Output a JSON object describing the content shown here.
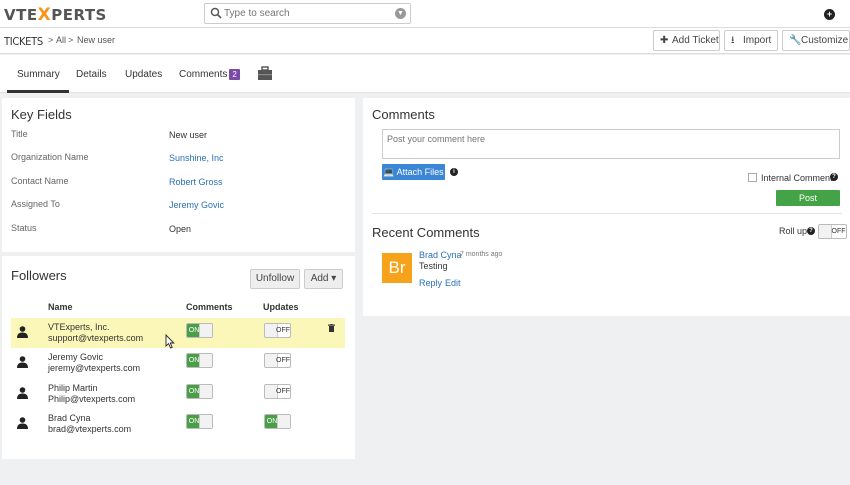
{
  "brand": {
    "prefix": "VTE",
    "x": "X",
    "suffix": "PERTS"
  },
  "search": {
    "placeholder": "Type to search"
  },
  "header": {
    "module": "TICKETS",
    "sep1": ">",
    "crumb_all": "All",
    "sep2": ">",
    "crumb_record": "New user",
    "add_ticket": "Add Ticket",
    "import": "Import",
    "customize": "Customize"
  },
  "tabs": {
    "summary": "Summary",
    "details": "Details",
    "updates": "Updates",
    "comments": "Comments",
    "comments_count": "2"
  },
  "key_fields": {
    "title": "Key Fields",
    "rows": [
      {
        "label": "Title",
        "value": "New user"
      },
      {
        "label": "Organization Name",
        "value": "Sunshine, Inc"
      },
      {
        "label": "Contact Name",
        "value": "Robert Gross"
      },
      {
        "label": "Assigned To",
        "value": "Jeremy Govic"
      },
      {
        "label": "Status",
        "value": "Open"
      }
    ]
  },
  "followers": {
    "title": "Followers",
    "unfollow": "Unfollow",
    "add": "Add",
    "col_name": "Name",
    "col_comments": "Comments",
    "col_updates": "Updates",
    "rows": [
      {
        "name": "VTExperts, Inc.",
        "email": "support@vtexperts.com",
        "comments": "ON",
        "updates": "OFF"
      },
      {
        "name": "Jeremy Govic",
        "email": "jeremy@vtexperts.com",
        "comments": "ON",
        "updates": "OFF"
      },
      {
        "name": "Philip Martin",
        "email": "Philip@vtexperts.com",
        "comments": "ON",
        "updates": "OFF"
      },
      {
        "name": "Brad Cyna",
        "email": "brad@vtexperts.com",
        "comments": "ON",
        "updates": "ON"
      }
    ]
  },
  "comments": {
    "title": "Comments",
    "placeholder": "Post your comment here",
    "attach": "Attach Files",
    "internal": "Internal Comment",
    "post": "Post",
    "recent_title": "Recent Comments",
    "rollup": "Roll up",
    "rollup_state": "OFF",
    "items": [
      {
        "avatar": "Br",
        "author": "Brad Cyna",
        "time": "7 months ago",
        "text": "Testing",
        "reply": "Reply",
        "edit": "Edit"
      }
    ]
  },
  "colors": {
    "accent": "#2a6fb8",
    "on": "#4a9e47",
    "badge": "#7b4aa6",
    "avatar": "#f6a21a",
    "highlight": "#fbf7b8"
  }
}
